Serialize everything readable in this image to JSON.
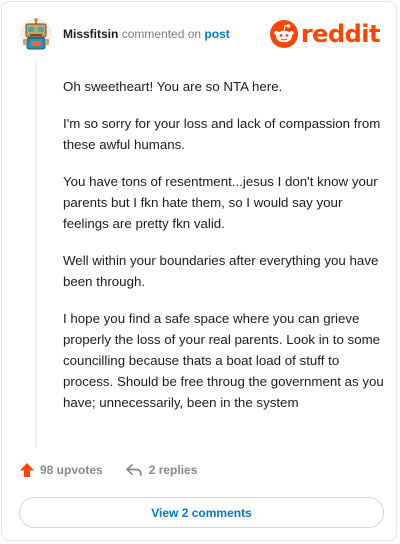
{
  "comment": {
    "username": "Missfitsin",
    "verb": "commented on",
    "target": "post",
    "paragraphs": [
      "Oh sweetheart! You are so NTA here.",
      "I'm so sorry for your loss and lack of compassion from these awful humans.",
      "You have tons of resentment...jesus I don't know your parents but I fkn hate them, so I would say your feelings are pretty fkn valid.",
      "Well within your boundaries after everything you have been through.",
      "I hope you find a safe space where you can grieve properly the loss of your real parents. Look in to some councilling because thats a boat load of stuff to process. Should be free throug the government as you have; unnecessarily, been in the system"
    ],
    "upvotes": "98 upvotes",
    "replies": "2 replies"
  },
  "brand": {
    "logo_text": "reddit",
    "accent": "#ff4500",
    "link": "#0079d3"
  },
  "actions": {
    "view_comments": "View 2 comments"
  },
  "icons": {
    "avatar": "robot-avatar",
    "logo": "reddit-snoo-icon",
    "upvote": "upvote-arrow-icon",
    "reply": "reply-arrow-icon"
  }
}
